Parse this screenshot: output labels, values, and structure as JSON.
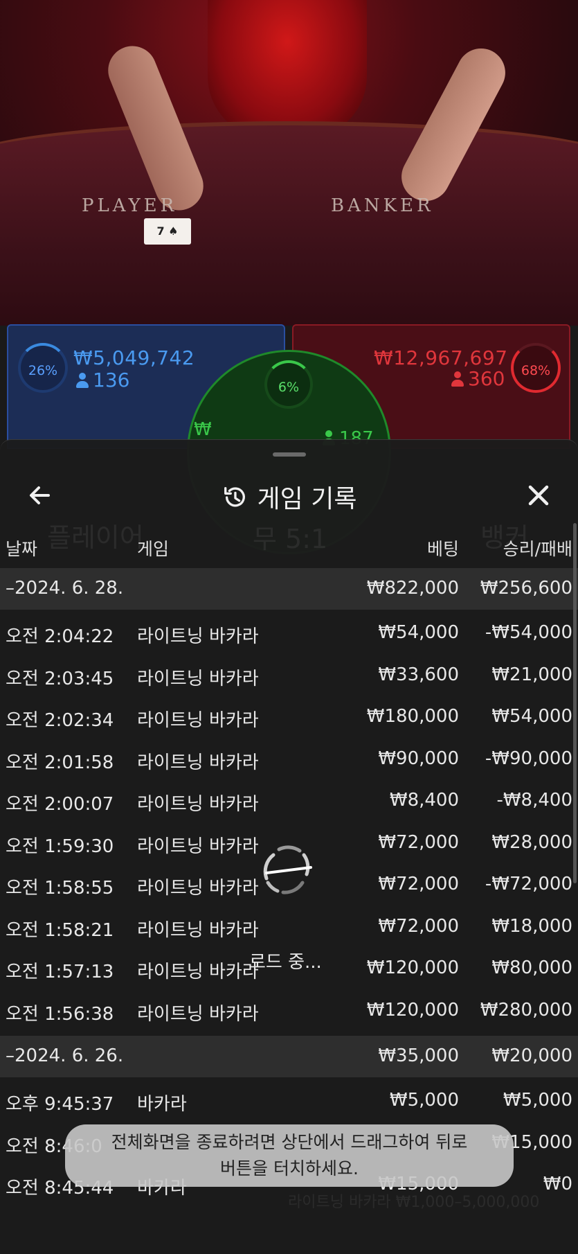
{
  "video": {
    "felt_player": "PLAYER",
    "felt_banker": "BANKER",
    "card": "7 ♠"
  },
  "bets": {
    "player": {
      "percent": "26%",
      "amount": "₩5,049,742",
      "players": "136",
      "color": "#4a9af0"
    },
    "banker": {
      "percent": "68%",
      "amount": "₩12,967,697",
      "players": "360",
      "color": "#e0363c"
    },
    "tie": {
      "percent": "6%",
      "amount_partial": "₩",
      "players_partial": "187",
      "color": "#3ac84a"
    }
  },
  "sheet": {
    "title": "게임 기록",
    "back_icon": "arrow-left-icon",
    "history_icon": "history-icon",
    "close_icon": "close-icon",
    "columns": {
      "date": "날짜",
      "game": "게임",
      "bet": "베팅",
      "result": "승리/패배"
    },
    "groups": [
      {
        "date": "–2024. 6. 28.",
        "total_bet": "₩822,000",
        "total_result": "₩256,600",
        "rows": [
          {
            "time": "오전 2:04:22",
            "game": "라이트닝 바카라",
            "bet": "₩54,000",
            "result": "-₩54,000"
          },
          {
            "time": "오전 2:03:45",
            "game": "라이트닝 바카라",
            "bet": "₩33,600",
            "result": "₩21,000"
          },
          {
            "time": "오전 2:02:34",
            "game": "라이트닝 바카라",
            "bet": "₩180,000",
            "result": "₩54,000"
          },
          {
            "time": "오전 2:01:58",
            "game": "라이트닝 바카라",
            "bet": "₩90,000",
            "result": "-₩90,000"
          },
          {
            "time": "오전 2:00:07",
            "game": "라이트닝 바카라",
            "bet": "₩8,400",
            "result": "-₩8,400"
          },
          {
            "time": "오전 1:59:30",
            "game": "라이트닝 바카라",
            "bet": "₩72,000",
            "result": "₩28,000"
          },
          {
            "time": "오전 1:58:55",
            "game": "라이트닝 바카라",
            "bet": "₩72,000",
            "result": "-₩72,000"
          },
          {
            "time": "오전 1:58:21",
            "game": "라이트닝 바카라",
            "bet": "₩72,000",
            "result": "₩18,000"
          },
          {
            "time": "오전 1:57:13",
            "game": "라이트닝 바카라",
            "bet": "₩120,000",
            "result": "₩80,000"
          },
          {
            "time": "오전 1:56:38",
            "game": "라이트닝 바카라",
            "bet": "₩120,000",
            "result": "₩280,000"
          }
        ]
      },
      {
        "date": "–2024. 6. 26.",
        "total_bet": "₩35,000",
        "total_result": "₩20,000",
        "rows": [
          {
            "time": "오후 9:45:37",
            "game": "바카라",
            "bet": "₩5,000",
            "result": "₩5,000"
          },
          {
            "time": "오전 8:46:0",
            "game": "",
            "bet": "",
            "result": "₩15,000"
          },
          {
            "time": "오전 8:45:44",
            "game": "바카라",
            "bet": "₩15,000",
            "result": "₩0"
          }
        ]
      }
    ],
    "loading": "로드 중...",
    "toast": [
      "전체화면을 종료하려면 상단에서 드래그하여 뒤로",
      "버튼을 터치하세요."
    ]
  },
  "ghost": {
    "player": "플레이어",
    "tie": "무 5:1",
    "banker": "뱅커",
    "footer": "라이트닝 바카라  ₩1,000–5,000,000"
  }
}
